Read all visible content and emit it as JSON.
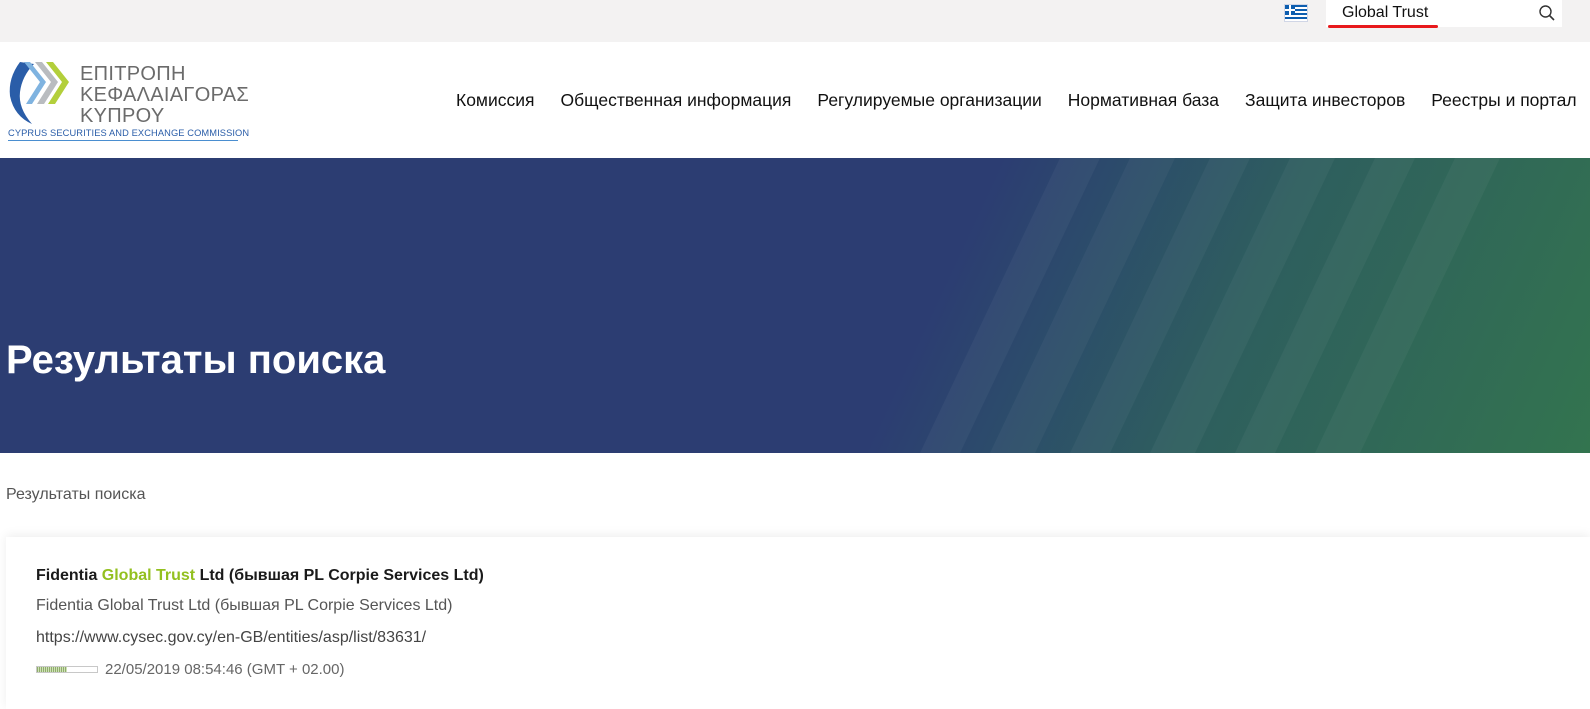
{
  "topbar": {
    "language_flag": "greek-flag-icon",
    "search": {
      "value": "Global Trust",
      "icon": "search-icon",
      "underline_color": "#e8191c"
    }
  },
  "logo": {
    "lines": [
      "ΕΠΙΤΡΟΠΗ",
      "ΚΕΦΑΛΑΙΑΓΟΡΑΣ",
      "ΚΥΠΡΟΥ"
    ],
    "subtitle": "CYPRUS SECURITIES AND EXCHANGE COMMISSION"
  },
  "nav": {
    "items": [
      "Комиссия",
      "Общественная информация",
      "Регулируемые организации",
      "Нормативная база",
      "Защита инвесторов",
      "Реестры и портал"
    ]
  },
  "hero": {
    "title": "Результаты поиска"
  },
  "breadcrumb": {
    "current": "Результаты поиска"
  },
  "results": [
    {
      "title_before": "Fidentia ",
      "title_highlight": "Global Trust",
      "title_after": " Ltd (бывшая PL Corpie Services Ltd)",
      "snippet": "Fidentia Global Trust Ltd (бывшая PL Corpie Services Ltd)",
      "url": "https://www.cysec.gov.cy/en-GB/entities/asp/list/83631/",
      "relevance": 0.5,
      "date": "22/05/2019 08:54:46 (GMT + 02.00)"
    }
  ],
  "colors": {
    "hero_blue": "#2c3d72",
    "hero_green": "#33744f",
    "highlight": "#93c01f",
    "logo_blue": "#2a5da8"
  }
}
